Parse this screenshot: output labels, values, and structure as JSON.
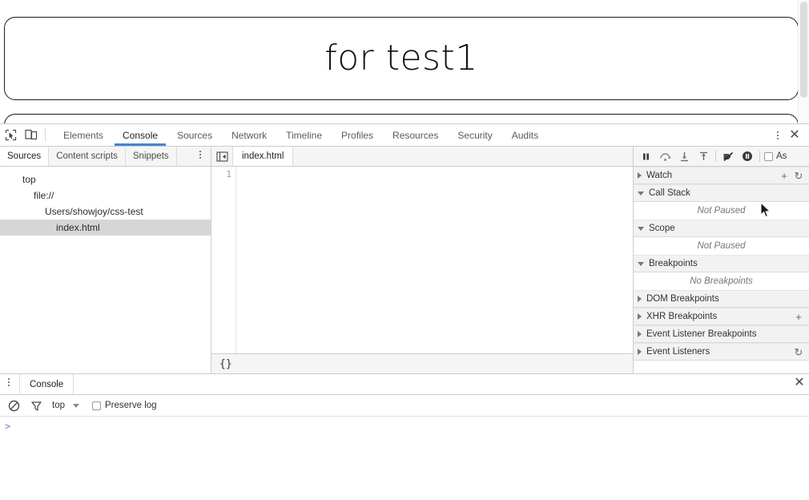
{
  "page": {
    "heading": "for test1",
    "scrollbar": "vertical-scrollbar"
  },
  "devtools": {
    "toolbar": {
      "inspect_icon": "inspect-cursor-icon",
      "device_icon": "device-toolbar-icon",
      "more_icon": "more-options-icon",
      "close_icon": "close-icon"
    },
    "main_tabs": [
      {
        "label": "Elements",
        "selected": false
      },
      {
        "label": "Console",
        "selected": true
      },
      {
        "label": "Sources",
        "selected": false
      },
      {
        "label": "Network",
        "selected": false
      },
      {
        "label": "Timeline",
        "selected": false
      },
      {
        "label": "Profiles",
        "selected": false
      },
      {
        "label": "Resources",
        "selected": false
      },
      {
        "label": "Security",
        "selected": false
      },
      {
        "label": "Audits",
        "selected": false
      }
    ],
    "navigator": {
      "tabs": [
        {
          "label": "Sources",
          "selected": true
        },
        {
          "label": "Content scripts",
          "selected": false
        },
        {
          "label": "Snippets",
          "selected": false
        }
      ],
      "more_icon": "more-options-icon",
      "tree": [
        {
          "label": "top",
          "depth": 0,
          "selected": false
        },
        {
          "label": "file://",
          "depth": 1,
          "selected": false
        },
        {
          "label": "Users/showjoy/css-test",
          "depth": 2,
          "selected": false
        },
        {
          "label": "index.html",
          "depth": 3,
          "selected": true
        }
      ]
    },
    "editor": {
      "nav_toggle_icon": "show-navigator-icon",
      "tabs": [
        {
          "label": "index.html",
          "selected": true
        }
      ],
      "line_numbers": [
        "1"
      ],
      "lines": [
        ""
      ],
      "statusbar": {
        "pretty_print_label": "{}"
      }
    },
    "debugger": {
      "controls": [
        {
          "name": "pause-script-execution-button",
          "icon": "pause-icon"
        },
        {
          "name": "step-over-button",
          "icon": "step-over-icon"
        },
        {
          "name": "step-into-button",
          "icon": "step-into-icon"
        },
        {
          "name": "step-out-button",
          "icon": "step-out-icon"
        },
        {
          "name": "deactivate-breakpoints-button",
          "icon": "deactivate-breakpoints-icon"
        },
        {
          "name": "pause-on-exceptions-button",
          "icon": "pause-on-exceptions-icon"
        }
      ],
      "async_label": "As",
      "panes": [
        {
          "title": "Watch",
          "expanded": false,
          "actions": [
            "add-icon",
            "refresh-icon"
          ],
          "body": null
        },
        {
          "title": "Call Stack",
          "expanded": true,
          "actions": [],
          "body": "Not Paused"
        },
        {
          "title": "Scope",
          "expanded": true,
          "actions": [],
          "body": "Not Paused"
        },
        {
          "title": "Breakpoints",
          "expanded": true,
          "actions": [],
          "body": "No Breakpoints"
        },
        {
          "title": "DOM Breakpoints",
          "expanded": false,
          "actions": [],
          "body": null
        },
        {
          "title": "XHR Breakpoints",
          "expanded": false,
          "actions": [
            "add-icon"
          ],
          "body": null
        },
        {
          "title": "Event Listener Breakpoints",
          "expanded": false,
          "actions": [],
          "body": null
        },
        {
          "title": "Event Listeners",
          "expanded": false,
          "actions": [
            "refresh-icon"
          ],
          "body": null
        }
      ]
    },
    "drawer": {
      "more_icon": "more-options-icon",
      "tabs": [
        {
          "label": "Console",
          "selected": true
        }
      ],
      "close_icon": "close-icon",
      "console_toolbar": {
        "clear_icon": "clear-console-icon",
        "filter_icon": "filter-icon",
        "context": "top",
        "preserve_log_label": "Preserve log",
        "preserve_log_checked": false
      },
      "prompt_caret": ">"
    }
  },
  "colors": {
    "accent": "#4285d4",
    "panel_bg": "#f5f5f5",
    "border": "#cdcdcd",
    "selected_row": "#d6d6d6",
    "text": "#303030",
    "muted_text": "#777777"
  }
}
